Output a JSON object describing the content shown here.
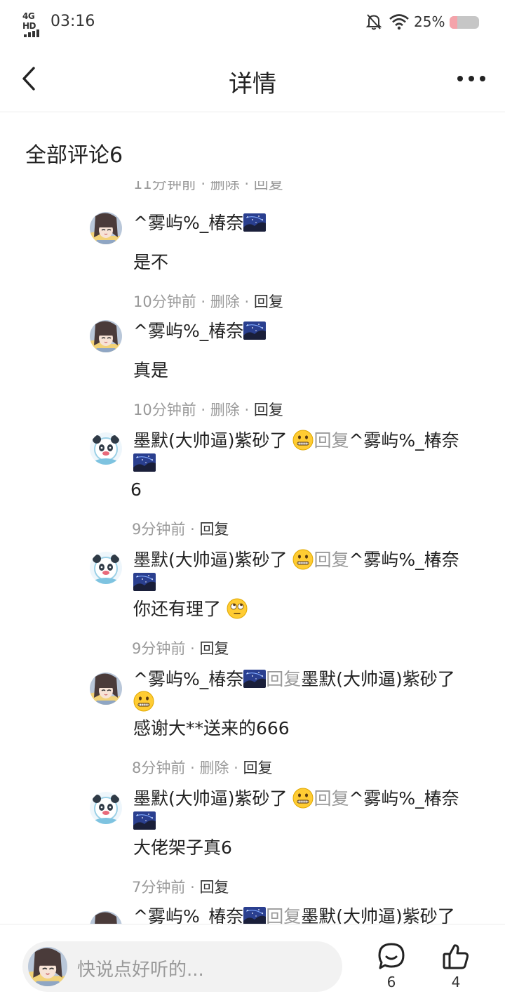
{
  "status_bar": {
    "network": "4G HD",
    "time": "03:16",
    "battery_percent": "25%",
    "battery_level": 0.25,
    "icons": [
      "signal-icon",
      "bell-off-icon",
      "wifi-icon",
      "battery-icon"
    ]
  },
  "header": {
    "title": "详情",
    "back_icon": "chevron-left-icon",
    "more_icon": "more-dots-icon"
  },
  "section_title": "全部评论6",
  "clipped_meta": "11分钟前 · 删除 · 回复",
  "comments": [
    {
      "user": "^雾屿%_椿奈",
      "avatar": "anime-girl",
      "reply_word": "",
      "reply_to": "",
      "text": "是不",
      "time": "10分钟前",
      "delete": "删除",
      "reply": "回复"
    },
    {
      "user": "^雾屿%_椿奈",
      "avatar": "anime-girl",
      "reply_word": "",
      "reply_to": "",
      "text": "真是",
      "time": "10分钟前",
      "delete": "删除",
      "reply": "回复"
    },
    {
      "user": "墨默(大帅逼)紫砂了",
      "avatar": "panda-girl",
      "reply_word": "回复",
      "reply_to": "^雾屿%_椿奈",
      "text": "6",
      "time": "9分钟前",
      "delete": "",
      "reply": "回复"
    },
    {
      "user": "墨默(大帅逼)紫砂了",
      "avatar": "panda-girl",
      "reply_word": "回复",
      "reply_to": "^雾屿%_椿奈",
      "text": "你还有理了",
      "time": "9分钟前",
      "delete": "",
      "reply": "回复"
    },
    {
      "user": "^雾屿%_椿奈",
      "avatar": "anime-girl",
      "reply_word": "回复",
      "reply_to": "墨默(大帅逼)紫砂了",
      "text": "感谢大**送来的666",
      "time": "8分钟前",
      "delete": "删除",
      "reply": "回复"
    },
    {
      "user": "墨默(大帅逼)紫砂了",
      "avatar": "panda-girl",
      "reply_word": "回复",
      "reply_to": "^雾屿%_椿奈",
      "text": "大佬架子真6",
      "time": "7分钟前",
      "delete": "",
      "reply": "回复"
    },
    {
      "user": "^雾屿%_椿奈",
      "avatar": "anime-girl",
      "reply_word": "回复",
      "reply_to": "墨默(大帅逼)紫砂了",
      "text": "",
      "time": "",
      "delete": "",
      "reply": ""
    }
  ],
  "bottom_bar": {
    "placeholder": "快说点好听的...",
    "comment_count": "6",
    "like_count": "4"
  },
  "colors": {
    "text": "#222222",
    "meta": "#999999",
    "reply_word": "#9a9a9a",
    "input_bg": "#f2f2f2",
    "battery_fill": "#f4a3aa"
  }
}
